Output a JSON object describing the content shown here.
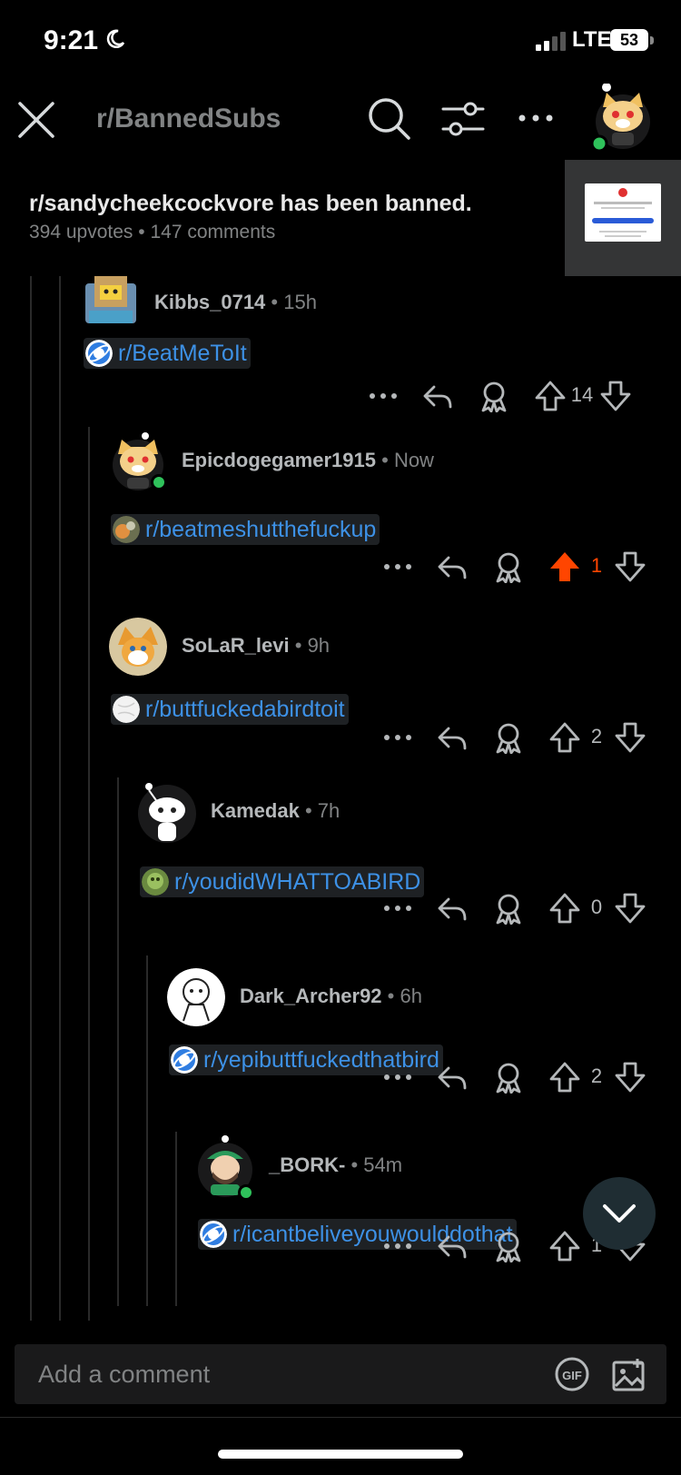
{
  "status": {
    "time": "9:21",
    "network": "LTE",
    "battery": "53"
  },
  "header": {
    "subreddit": "r/BannedSubs"
  },
  "post": {
    "title": "r/sandycheekcockvore has been banned.",
    "upvotes": "394 upvotes",
    "dot": "•",
    "comments": "147 comments"
  },
  "comments": [
    {
      "user": "Kibbs_0714",
      "time": "15h",
      "link": "r/BeatMeToIt",
      "votes": "14",
      "upvoted": false
    },
    {
      "user": "Epicdogegamer1915",
      "time": "Now",
      "link": "r/beatmeshutthefuckup",
      "votes": "1",
      "upvoted": true
    },
    {
      "user": "SoLaR_levi",
      "time": "9h",
      "link": "r/buttfuckedabirdtoit",
      "votes": "2",
      "upvoted": false
    },
    {
      "user": "Kamedak",
      "time": "7h",
      "link": "r/youdidWHATTOABIRD",
      "votes": "0",
      "upvoted": false
    },
    {
      "user": "Dark_Archer92",
      "time": "6h",
      "link": "r/yepibuttfuckedthatbird",
      "votes": "2",
      "upvoted": false
    },
    {
      "user": "_BORK-",
      "time": "54m",
      "link": "r/icantbeliveyouwoulddothat",
      "votes": "1",
      "upvoted": false
    }
  ],
  "comment_bar": {
    "placeholder": "Add a comment",
    "gif_label": "GIF"
  },
  "colors": {
    "link": "#3d91e6",
    "upvote": "#ff4500",
    "online": "#2fc25b",
    "background": "#000000"
  },
  "icons": [
    "close-icon",
    "search-icon",
    "filter-icon",
    "more-icon",
    "reply-icon",
    "award-icon",
    "upvote-icon",
    "downvote-icon",
    "chevron-down-icon",
    "gif-icon",
    "image-icon"
  ]
}
